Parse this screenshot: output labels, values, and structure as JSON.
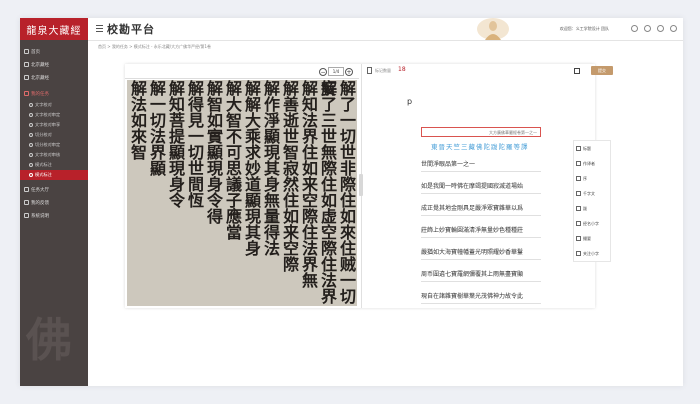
{
  "app": {
    "logo": "龍泉大藏經",
    "title": "校勘平台",
    "user_text": "欢迎您：义工学院设计 团队",
    "breadcrumb": "首页 > 我的任务 > 模式标注 - 永乐北藏/大方广佛华严经/第1卷"
  },
  "sidebar": {
    "items": [
      {
        "label": "首页",
        "type": "top"
      },
      {
        "label": "北京藏经",
        "type": "top"
      },
      {
        "label": "北京藏经",
        "type": "top"
      },
      {
        "label": "我的任务",
        "type": "group"
      },
      {
        "label": "文字校对",
        "type": "sub"
      },
      {
        "label": "文字校对审定",
        "type": "sub"
      },
      {
        "label": "文字校对审享",
        "type": "sub"
      },
      {
        "label": "切分校对",
        "type": "sub"
      },
      {
        "label": "切分校对审定",
        "type": "sub"
      },
      {
        "label": "文字校对审核",
        "type": "sub"
      },
      {
        "label": "模式标注",
        "type": "sub"
      },
      {
        "label": "模式标注",
        "type": "active"
      },
      {
        "label": "任务大厅",
        "type": "top"
      },
      {
        "label": "我的反馈",
        "type": "top"
      },
      {
        "label": "系统说明",
        "type": "top"
      }
    ],
    "bg_char": "佛"
  },
  "viewer": {
    "zoom_minus": "−",
    "zoom_value": "1/4",
    "zoom_plus": "+",
    "columns": [
      "解了一切世非際住如來住贼一切妄",
      "解了三世無際住如虚空際住法界",
      "解知法界住如来空際住法界無",
      "解善逝世智寂然住如来空際",
      "解作淨顯現其身無量得法",
      "解解大乘求妙道顯現其身",
      "解大智不可思議子應當",
      "解智如實顯現身令得",
      "解得見一切世間恆",
      "解知菩提顯現身令",
      "解一切法界顯",
      "解法如來智"
    ]
  },
  "editor": {
    "mark_label": "标记数量",
    "mark_count": "18",
    "submit_label": "提交",
    "p_label": "p",
    "selected_text": "大方廣佛華嚴經卷第一之一",
    "blue_line": "東晉天竺三藏佛陀跋陀羅等譯",
    "lines": [
      "世間淨眼品第一之一",
      "如是我聞一時佛在摩竭提國寂滅道場始",
      "成正覺其地金剛具足嚴淨眾寶雜華以爲",
      "莊飾上妙寶輪圓滿清淨無量妙色種種莊",
      "嚴猶如大海寶幢幡蓋光明照耀妙香華鬘",
      "周币圍遶七寶羅網彌覆其上雨無盡寶顯",
      "現自在諸雜寶樹華葉光茂佛神力故令此"
    ],
    "tools": [
      "标题",
      "作译者",
      "序",
      "千字文",
      "跋",
      "经名小字",
      "撮要",
      "夹注小字"
    ]
  },
  "colors": {
    "accent": "#b8212a",
    "sidebar_bg": "#4a4342",
    "submit": "#c49a6c",
    "blue_text": "#4aa0d8"
  }
}
